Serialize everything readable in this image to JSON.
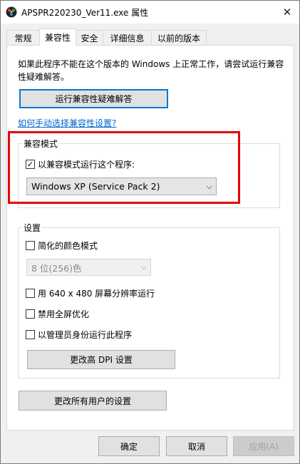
{
  "window": {
    "title": "APSPR220230_Ver11.exe 属性",
    "close_glyph": "✕"
  },
  "tabs": [
    {
      "label": "常规",
      "active": false
    },
    {
      "label": "兼容性",
      "active": true
    },
    {
      "label": "安全",
      "active": false
    },
    {
      "label": "详细信息",
      "active": false
    },
    {
      "label": "以前的版本",
      "active": false
    }
  ],
  "compat": {
    "description": "如果此程序不能在这个版本的 Windows 上正常工作，请尝试运行兼容性疑难解答。",
    "troubleshoot_button": "运行兼容性疑难解答",
    "manual_link": "如何手动选择兼容性设置?"
  },
  "mode_group": {
    "title": "兼容模式",
    "checkbox_label": "以兼容模式运行这个程序:",
    "checked": true,
    "selected_os": "Windows XP (Service Pack 2)"
  },
  "settings_group": {
    "title": "设置",
    "reduced_color_label": "简化的颜色模式",
    "color_depth_selected": "8 位(256)色",
    "resolution_label": "用 640 x 480 屏幕分辨率运行",
    "fullscreen_label": "禁用全屏优化",
    "admin_label": "以管理员身份运行此程序",
    "dpi_button": "更改高 DPI 设置"
  },
  "all_users_button": "更改所有用户的设置",
  "footer": {
    "ok": "确定",
    "cancel": "取消",
    "apply": "应用(A)"
  },
  "colors": {
    "highlight_box": "#e60000",
    "focus_border": "#0078d7",
    "link": "#0066cc"
  }
}
